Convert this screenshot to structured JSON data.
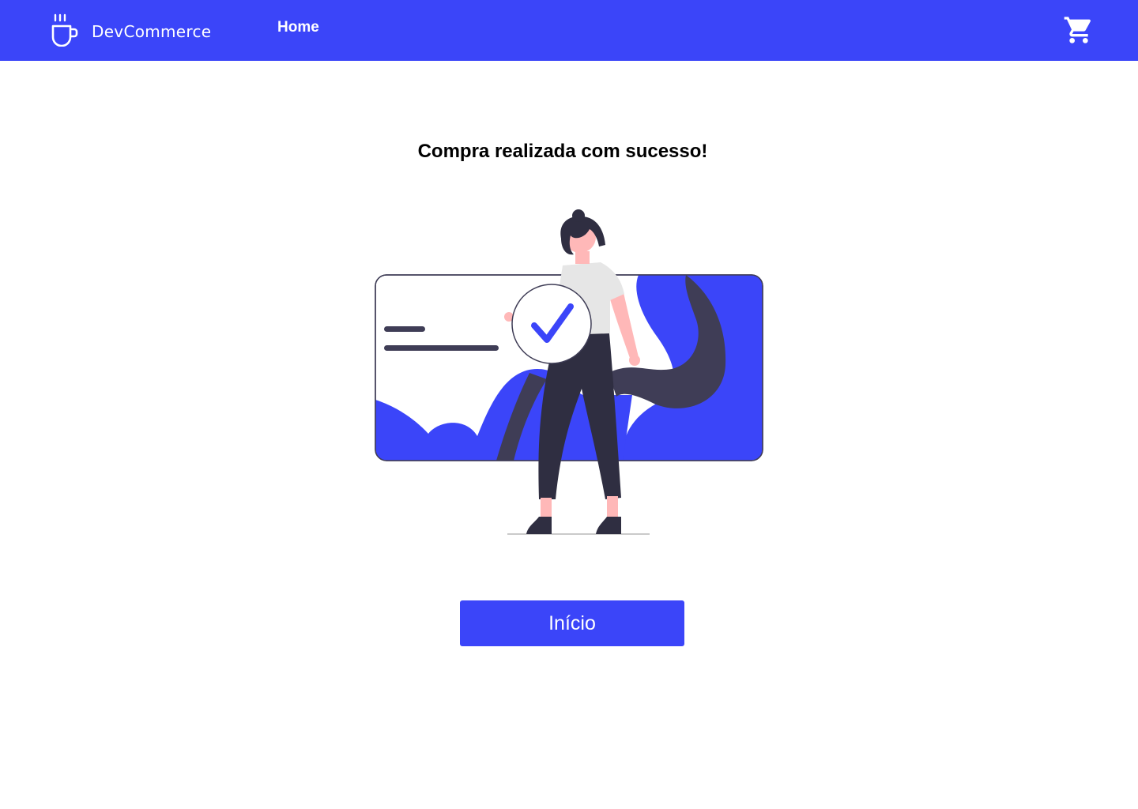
{
  "header": {
    "brand_name": "DevCommerce",
    "brand_icon": "coffee-cup-icon",
    "nav": {
      "home_label": "Home"
    },
    "cart_icon": "shopping-cart-icon"
  },
  "main": {
    "title": "Compra realizada com sucesso!",
    "illustration_icon": "order-confirmed-illustration",
    "home_button_label": "Início"
  },
  "colors": {
    "primary": "#3b45f9",
    "dark": "#3f3d56",
    "skin": "#ffb8b8",
    "shirt": "#e6e6e6",
    "pants": "#2f2e41",
    "background": "#ffffff"
  }
}
